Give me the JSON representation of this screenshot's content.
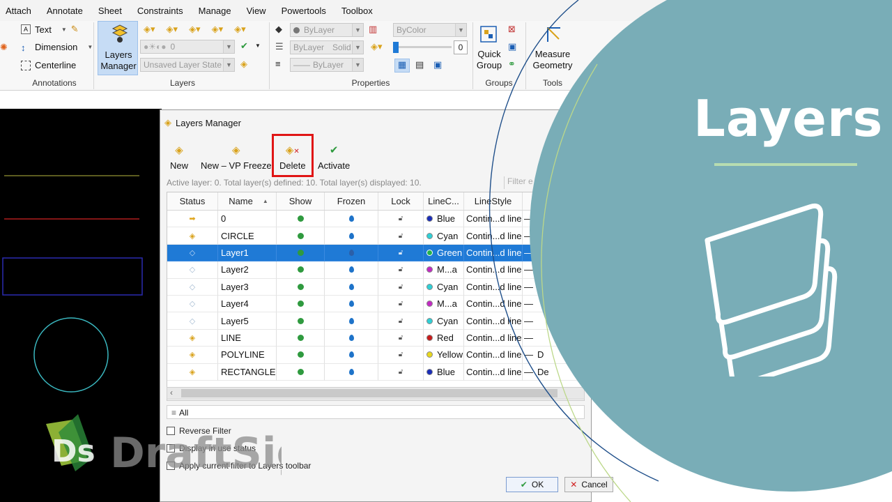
{
  "menu": [
    "Attach",
    "Annotate",
    "Sheet",
    "Constraints",
    "Manage",
    "View",
    "Powertools",
    "Toolbox"
  ],
  "ribbon": {
    "annotations": {
      "title": "Annotations",
      "text": "Text",
      "dimension": "Dimension",
      "centerline": "Centerline"
    },
    "layers": {
      "title": "Layers",
      "manager_line1": "Layers",
      "manager_line2": "Manager",
      "layer_combo": "0",
      "state_combo": "Unsaved Layer State"
    },
    "properties": {
      "title": "Properties",
      "color": "ByLayer",
      "linestyle_layer": "ByLayer",
      "linestyle_solid": "Solid",
      "lineweight": "ByLayer",
      "plotstyle": "ByColor",
      "transparency": "0"
    },
    "groups": {
      "title": "Groups",
      "quick_line1": "Quick",
      "quick_line2": "Group"
    },
    "tools": {
      "title": "Tools",
      "measure_line1": "Measure",
      "measure_line2": "Geometry"
    }
  },
  "dialog": {
    "title": "Layers Manager",
    "toolbar": {
      "new": "New",
      "new_vp": "New – VP Freeze",
      "delete": "Delete",
      "activate": "Activate"
    },
    "info": "Active layer: 0. Total layer(s) defined: 10. Total layer(s) displayed: 10.",
    "filter_placeholder": "Filter e",
    "columns": {
      "status": "Status",
      "name": "Name",
      "show": "Show",
      "frozen": "Frozen",
      "lock": "Lock",
      "linecolor": "LineC...",
      "linestyle": "LineStyle"
    },
    "rows": [
      {
        "name": "0",
        "color": "Blue",
        "color_hex": "#1a2db8",
        "style": "Contin...d line",
        "rest": "",
        "status": "active"
      },
      {
        "name": "CIRCLE",
        "color": "Cyan",
        "color_hex": "#2fd0d6",
        "style": "Contin...d line",
        "rest": "",
        "status": "used"
      },
      {
        "name": "Layer1",
        "color": "Green",
        "color_hex": "#22b24c",
        "style": "Contin...d line",
        "rest": "",
        "status": "empty",
        "selected": true
      },
      {
        "name": "Layer2",
        "color": "M...a",
        "color_hex": "#c22ac2",
        "style": "Contin...d line",
        "rest": "",
        "status": "empty"
      },
      {
        "name": "Layer3",
        "color": "Cyan",
        "color_hex": "#2fd0d6",
        "style": "Contin...d line",
        "rest": "",
        "status": "empty"
      },
      {
        "name": "Layer4",
        "color": "M...a",
        "color_hex": "#c22ac2",
        "style": "Contin...d line",
        "rest": "",
        "status": "empty"
      },
      {
        "name": "Layer5",
        "color": "Cyan",
        "color_hex": "#2fd0d6",
        "style": "Contin...d line",
        "rest": "",
        "status": "empty"
      },
      {
        "name": "LINE",
        "color": "Red",
        "color_hex": "#c81b1b",
        "style": "Contin...d line",
        "rest": "",
        "status": "used"
      },
      {
        "name": "POLYLINE",
        "color": "Yellow",
        "color_hex": "#e8d81e",
        "style": "Contin...d line",
        "rest": "D",
        "status": "used"
      },
      {
        "name": "RECTANGLE",
        "color": "Blue",
        "color_hex": "#1a2db8",
        "style": "Contin...d line",
        "rest": "De",
        "status": "used"
      }
    ],
    "filter_all": "All",
    "reverse_filter": "Reverse Filter",
    "display_in_use": "Display in use status",
    "apply_filter": "Apply current filter to Layers toolbar",
    "ok": "OK",
    "cancel": "Cancel"
  },
  "brand": {
    "title": "Layers",
    "logo_text": "DraftSight"
  },
  "colors": {
    "teal": "#79adb7",
    "selection": "#1f7ad6",
    "highlight": "#e01515"
  }
}
